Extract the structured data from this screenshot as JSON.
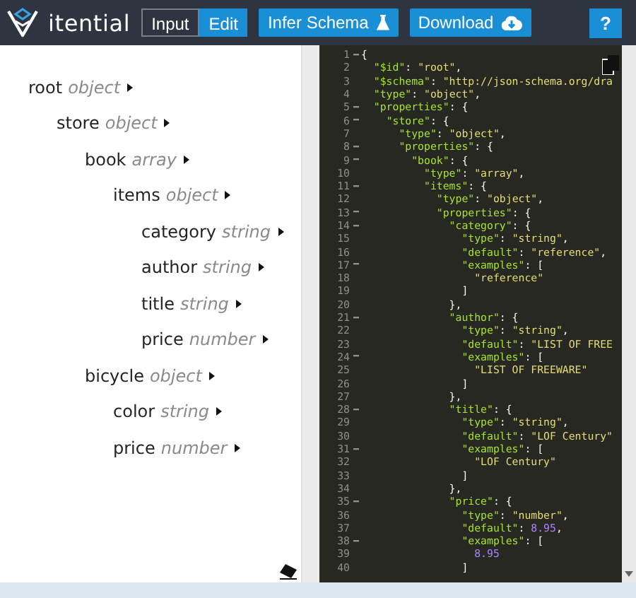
{
  "header": {
    "brand": "itential",
    "mode_tabs": [
      {
        "label": "Input",
        "selected": false
      },
      {
        "label": "Edit",
        "selected": true
      }
    ],
    "buttons": [
      {
        "label": "Infer Schema",
        "kind": "flask"
      },
      {
        "label": "Download",
        "kind": "cloud"
      }
    ],
    "help_button": "?"
  },
  "tree": [
    {
      "name": "root",
      "type": "object",
      "children": [
        {
          "name": "store",
          "type": "object",
          "children": [
            {
              "name": "book",
              "type": "array",
              "children": [
                {
                  "name": "items",
                  "type": "object",
                  "children": [
                    {
                      "name": "category",
                      "type": "string"
                    },
                    {
                      "name": "author",
                      "type": "string"
                    },
                    {
                      "name": "title",
                      "type": "string"
                    },
                    {
                      "name": "price",
                      "type": "number"
                    }
                  ]
                }
              ]
            },
            {
              "name": "bicycle",
              "type": "object",
              "children": [
                {
                  "name": "color",
                  "type": "string"
                },
                {
                  "name": "price",
                  "type": "number"
                }
              ]
            }
          ]
        }
      ]
    }
  ],
  "editor": {
    "lines": [
      {
        "number": "1",
        "code": "{",
        "foldable": true
      },
      {
        "number": "2",
        "code": "  \"$id\": \"root\",",
        "foldable": false
      },
      {
        "number": "3",
        "code": "  \"$schema\": \"http://json-schema.org/dra",
        "foldable": false
      },
      {
        "number": "4",
        "code": "  \"type\": \"object\",",
        "foldable": false
      },
      {
        "number": "5",
        "code": "  \"properties\": {",
        "foldable": true
      },
      {
        "number": "6",
        "code": "    \"store\": {",
        "foldable": true
      },
      {
        "number": "7",
        "code": "      \"type\": \"object\",",
        "foldable": false
      },
      {
        "number": "8",
        "code": "      \"properties\": {",
        "foldable": true
      },
      {
        "number": "9",
        "code": "        \"book\": {",
        "foldable": true
      },
      {
        "number": "10",
        "code": "          \"type\": \"array\",",
        "foldable": false
      },
      {
        "number": "11",
        "code": "          \"items\": {",
        "foldable": true
      },
      {
        "number": "12",
        "code": "            \"type\": \"object\",",
        "foldable": false
      },
      {
        "number": "13",
        "code": "            \"properties\": {",
        "foldable": true
      },
      {
        "number": "14",
        "code": "              \"category\": {",
        "foldable": true
      },
      {
        "number": "15",
        "code": "                \"type\": \"string\",",
        "foldable": false
      },
      {
        "number": "16",
        "code": "                \"default\": \"reference\",",
        "foldable": false
      },
      {
        "number": "17",
        "code": "                \"examples\": [",
        "foldable": true
      },
      {
        "number": "18",
        "code": "                  \"reference\"",
        "foldable": false
      },
      {
        "number": "19",
        "code": "                ]",
        "foldable": false
      },
      {
        "number": "20",
        "code": "              },",
        "foldable": false
      },
      {
        "number": "21",
        "code": "              \"author\": {",
        "foldable": true
      },
      {
        "number": "22",
        "code": "                \"type\": \"string\",",
        "foldable": false
      },
      {
        "number": "23",
        "code": "                \"default\": \"LIST OF FREE",
        "foldable": false
      },
      {
        "number": "24",
        "code": "                \"examples\": [",
        "foldable": true
      },
      {
        "number": "25",
        "code": "                  \"LIST OF FREEWARE\"",
        "foldable": false
      },
      {
        "number": "26",
        "code": "                ]",
        "foldable": false
      },
      {
        "number": "27",
        "code": "              },",
        "foldable": false
      },
      {
        "number": "28",
        "code": "              \"title\": {",
        "foldable": true
      },
      {
        "number": "29",
        "code": "                \"type\": \"string\",",
        "foldable": false
      },
      {
        "number": "30",
        "code": "                \"default\": \"LOF Century\"",
        "foldable": false
      },
      {
        "number": "31",
        "code": "                \"examples\": [",
        "foldable": true
      },
      {
        "number": "32",
        "code": "                  \"LOF Century\"",
        "foldable": false
      },
      {
        "number": "33",
        "code": "                ]",
        "foldable": false
      },
      {
        "number": "34",
        "code": "              },",
        "foldable": false
      },
      {
        "number": "35",
        "code": "              \"price\": {",
        "foldable": true
      },
      {
        "number": "36",
        "code": "                \"type\": \"number\",",
        "foldable": false
      },
      {
        "number": "37",
        "code": "                \"default\": 8.95,",
        "foldable": false
      },
      {
        "number": "38",
        "code": "                \"examples\": [",
        "foldable": true
      },
      {
        "number": "39",
        "code": "                  8.95",
        "foldable": false
      },
      {
        "number": "40",
        "code": "                ]",
        "foldable": false
      }
    ]
  }
}
